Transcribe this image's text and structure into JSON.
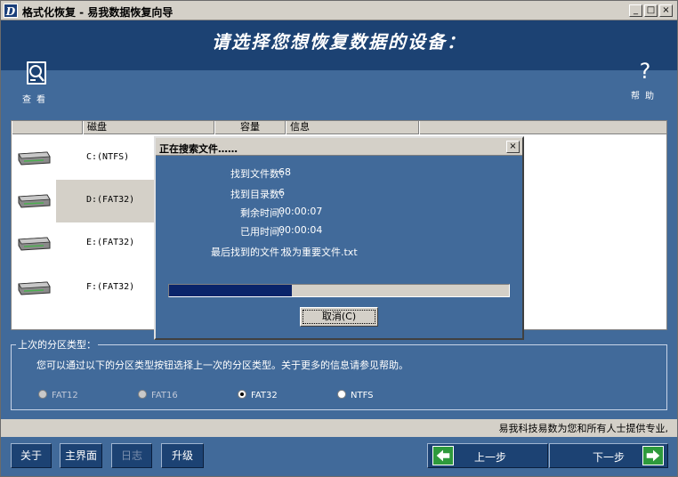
{
  "window": {
    "title": "格式化恢复 - 易我数据恢复向导",
    "logo_letter": "D",
    "minimize": "_",
    "maximize": "□",
    "close": "×"
  },
  "header": {
    "title": "请选择您想恢复数据的设备："
  },
  "toolbar": {
    "view_label": "查看",
    "help_label": "帮助",
    "help_glyph": "?"
  },
  "disk_list": {
    "columns": [
      "",
      "磁盘",
      "容量",
      "信息",
      ""
    ],
    "items": [
      {
        "label": "C:(NTFS)",
        "selected": false
      },
      {
        "label": "D:(FAT32)",
        "selected": true
      },
      {
        "label": "E:(FAT32)",
        "selected": false
      },
      {
        "label": "F:(FAT32)",
        "selected": false
      }
    ]
  },
  "partition_group": {
    "title": "上次的分区类型：",
    "description": "您可以通过以下的分区类型按钮选择上一次的分区类型。关于更多的信息请参见帮助。",
    "options": [
      {
        "label": "FAT12",
        "checked": false,
        "enabled": false
      },
      {
        "label": "FAT16",
        "checked": false,
        "enabled": false
      },
      {
        "label": "FAT32",
        "checked": true,
        "enabled": true
      },
      {
        "label": "NTFS",
        "checked": false,
        "enabled": true
      }
    ]
  },
  "marquee": "易我科技易数为您和所有人士提供专业,",
  "buttons": {
    "about": "关于",
    "main": "主界面",
    "log": "日志",
    "upgrade": "升级",
    "prev": "上一步",
    "next": "下一步"
  },
  "dialog": {
    "title": "正在搜索文件……",
    "files_found_label": "找到文件数：",
    "files_found": "68",
    "dirs_found_label": "找到目录数：",
    "dirs_found": "6",
    "remaining_label": "剩余时间：",
    "remaining": "00:00:07",
    "elapsed_label": "已用时间：",
    "elapsed": "00:00:04",
    "last_file_label": "最后找到的文件：",
    "last_file": "极为重要文件.txt",
    "close": "×",
    "cancel_label": "取消(C)",
    "progress": 0.36
  },
  "colors": {
    "window_bg": "#416a9a",
    "header_bg": "#1c4273",
    "progress_fill": "#0a246a",
    "nav_arrow": "#2e9a3c"
  }
}
